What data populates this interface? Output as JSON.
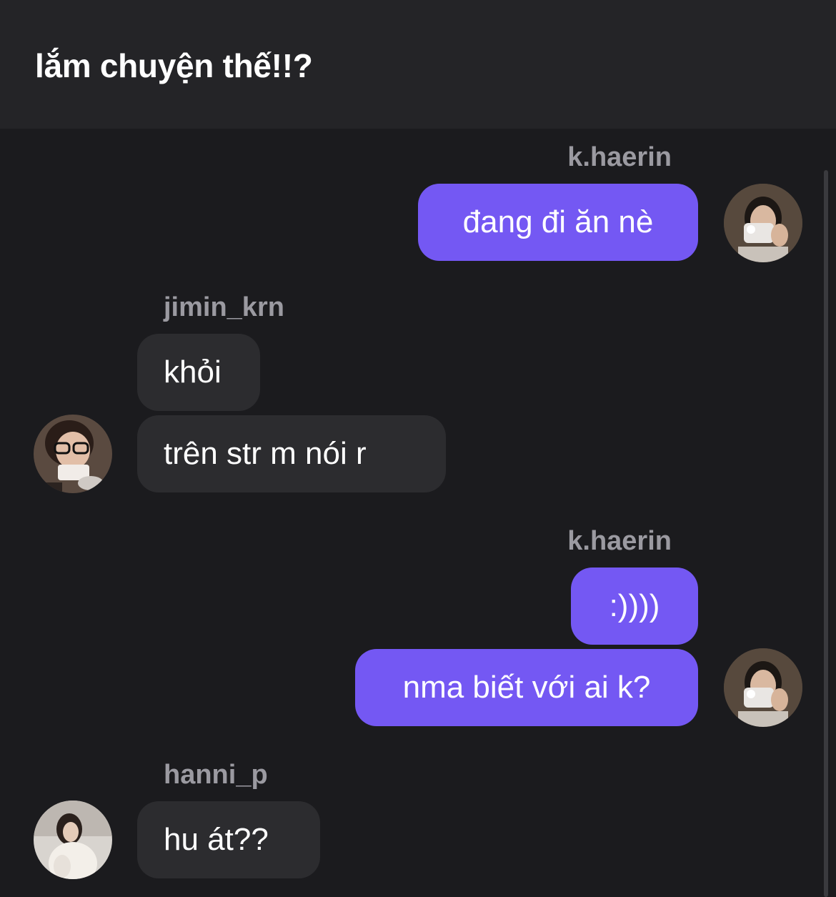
{
  "header": {
    "title": "lắm chuyện thế!!?"
  },
  "messages": [
    {
      "user": "k.haerin",
      "texts": [
        "đang đi ăn nè"
      ]
    },
    {
      "user": "jimin_krn",
      "texts": [
        "khỏi",
        "trên str m nói r"
      ]
    },
    {
      "user": "k.haerin",
      "texts": [
        ":))))",
        "nma biết với ai k?"
      ]
    },
    {
      "user": "hanni_p",
      "texts": [
        "hu át??"
      ]
    }
  ],
  "colors": {
    "outgoing_bubble": "#7458f3",
    "incoming_bubble": "#2c2c2f",
    "background": "#1b1b1e",
    "header_bg": "#242427",
    "username": "#9b9aa1"
  },
  "icons": [
    "avatar-haerin",
    "avatar-jimin",
    "avatar-hanni"
  ]
}
